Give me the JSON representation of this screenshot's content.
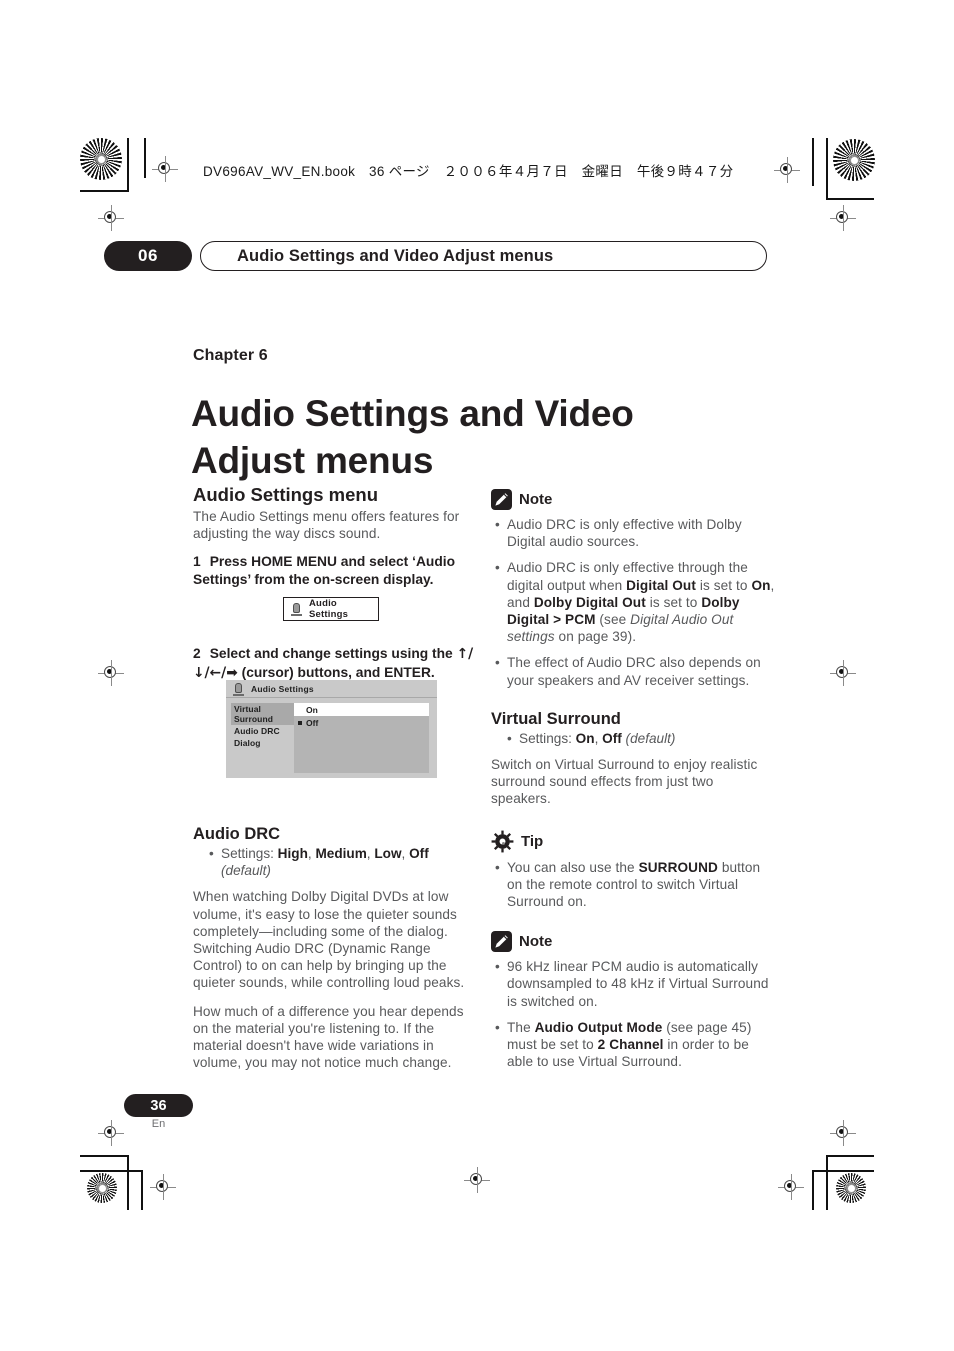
{
  "print_marks": {
    "file_info": "DV696AV_WV_EN.book　36 ページ　２００６年４月７日　金曜日　午後９時４７分"
  },
  "running_header": {
    "chapter_number": "06",
    "title": "Audio Settings and Video Adjust menus"
  },
  "chapter": {
    "label": "Chapter 6",
    "title": "Audio Settings and Video Adjust menus"
  },
  "left_column": {
    "section_heading": "Audio Settings menu",
    "intro": "The Audio Settings menu offers features for adjusting the way discs sound.",
    "step1_number": "1",
    "step1_text": "Press HOME MENU and select ‘Audio Settings’ from the on-screen display.",
    "step2_number": "2",
    "step2_text_a": "Select and change settings using the ",
    "step2_arrows_a": "↑/",
    "step2_arrows_b": "↓/←/➡",
    "step2_text_b": " (cursor) buttons, and ENTER.",
    "figure_button": {
      "icon": "speaker-icon",
      "label": "Audio Settings"
    },
    "figure_osd": {
      "title": "Audio Settings",
      "title_icon": "speaker-icon",
      "menu_items": [
        "Virtual Surround",
        "Audio DRC",
        "Dialog"
      ],
      "selected_menu_item": "Virtual Surround",
      "options": [
        "On",
        "Off"
      ],
      "highlighted_option": "On",
      "marked_option": "Off"
    },
    "audio_drc": {
      "heading": "Audio DRC",
      "settings_label": "Settings: ",
      "settings_values": [
        "High",
        "Medium",
        "Low",
        "Off"
      ],
      "settings_default": "(default)",
      "paragraph1": "When watching Dolby Digital DVDs at low volume, it's easy to lose the quieter sounds completely—including some of the dialog. Switching Audio DRC (Dynamic Range Control) to on can help by bringing up the quieter sounds, while controlling loud peaks.",
      "paragraph2": "How much of a difference you hear depends on the material you're listening to. If the material doesn't have wide variations in volume, you may not notice much change."
    }
  },
  "right_column": {
    "note1": {
      "icon": "pencil-note-icon",
      "label": "Note",
      "bullet1": "Audio DRC is only effective with Dolby Digital audio sources.",
      "bullet2_p1": "Audio DRC is only effective through the digital output when ",
      "bullet2_b1": "Digital Out",
      "bullet2_p2": " is set to ",
      "bullet2_b2": "On",
      "bullet2_p3": ", and ",
      "bullet2_b3": "Dolby Digital Out",
      "bullet2_p4": " is set to ",
      "bullet2_b4": "Dolby Digital > PCM",
      "bullet2_p5": " (see ",
      "bullet2_i1": "Digital Audio Out settings",
      "bullet2_p6": " on page 39).",
      "bullet3": "The effect of Audio DRC also depends on your speakers and AV receiver settings."
    },
    "virtual_surround": {
      "heading": "Virtual Surround",
      "settings_label": "Settings: ",
      "settings_values": [
        "On",
        "Off"
      ],
      "settings_default": "(default)",
      "paragraph": "Switch on Virtual Surround to enjoy realistic surround sound effects from just two speakers."
    },
    "tip": {
      "icon": "gear-tip-icon",
      "label": "Tip",
      "bullet1_p1": "You can also use the ",
      "bullet1_b1": "SURROUND",
      "bullet1_p2": " button on the remote control to switch Virtual Surround on."
    },
    "note2": {
      "icon": "pencil-note-icon",
      "label": "Note",
      "bullet1": "96 kHz linear PCM audio is automatically downsampled to 48 kHz if Virtual Surround is switched on.",
      "bullet2_p1": "The ",
      "bullet2_b1": "Audio Output Mode",
      "bullet2_p2": " (see page 45) must be set to ",
      "bullet2_b2": "2 Channel",
      "bullet2_p3": " in order to be able to use Virtual Surround."
    }
  },
  "footer": {
    "page_number": "36",
    "language": "En"
  }
}
